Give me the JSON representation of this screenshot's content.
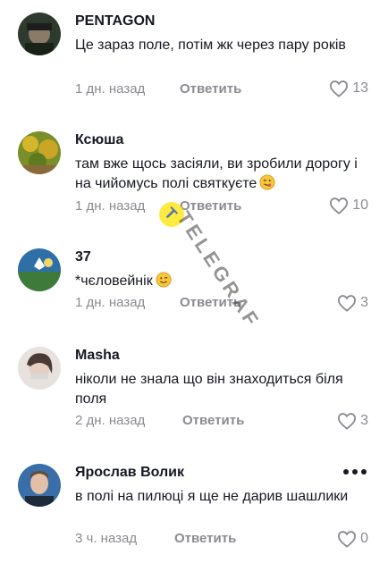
{
  "comments": [
    {
      "username": "PENTAGON",
      "text": "Це зараз поле, потім жк через пару років",
      "time": "1 дн. назад",
      "reply_label": "Ответить",
      "likes": "13",
      "avatar": "avatar-pentagon"
    },
    {
      "username": "Ксюша",
      "text": "там вже щось засіяли, ви зробили дорогу і на чийомусь полі святкуєте",
      "emoji": "winking-tongue-emoji",
      "time": "1 дн. назад",
      "reply_label": "Ответить",
      "likes": "10",
      "avatar": "avatar-ksyusha"
    },
    {
      "username": "37",
      "text": "*чєловейнік",
      "emoji": "winking-emoji",
      "time": "1 дн. назад",
      "reply_label": "Ответить",
      "likes": "3",
      "avatar": "avatar-37"
    },
    {
      "username": "Masha",
      "text": "ніколи не знала що він знаходиться біля поля",
      "time": "2 дн. назад",
      "reply_label": "Ответить",
      "likes": "3",
      "avatar": "avatar-masha"
    },
    {
      "username": "Ярослав Волик",
      "text": "в полі на пилюці я ще не дарив шашлики",
      "time": "3 ч. назад",
      "reply_label": "Ответить",
      "likes": "0",
      "avatar": "avatar-yaroslav"
    }
  ],
  "watermark": {
    "text": "TELEGRAF",
    "logo": "T"
  },
  "colors": {
    "text": "#161823",
    "muted": "#8a8b91",
    "watermark_yellow": "#ffe400"
  }
}
